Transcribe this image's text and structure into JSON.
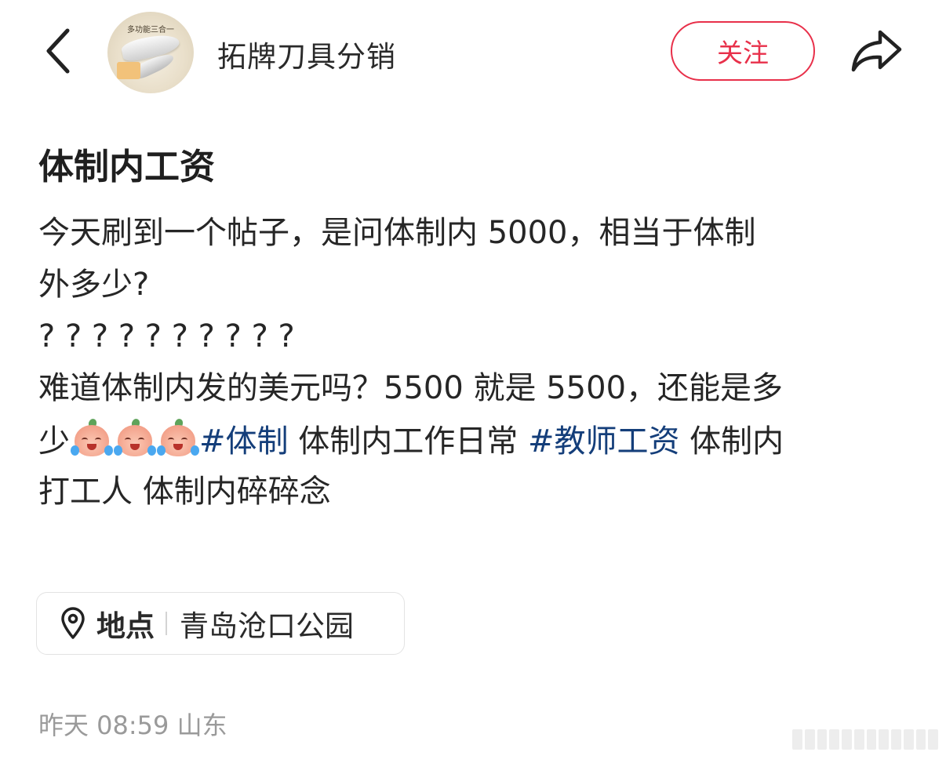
{
  "header": {
    "back_icon": "chevron-left-icon",
    "avatar_caption": "多功能三合一",
    "account_name": "拓牌刀具分销",
    "follow_label": "关注",
    "share_icon": "share-arrow-icon"
  },
  "post": {
    "title": "体制内工资",
    "body": {
      "line1": "今天刷到一个帖子，是问体制内 5000，相当于体制",
      "line2": "外多少?",
      "line3": "? ? ? ? ? ? ? ? ? ?",
      "line4": "难道体制内发的美元吗？5500 就是 5500，还能是多",
      "line5_prefix": "少",
      "emoji_name": "crying-peach-emoji",
      "hashtag1": "#体制",
      "tag_text1": " 体制内工作日常 ",
      "hashtag2": "#教师工资",
      "tag_text2": " 体制内",
      "line6": "打工人 体制内碎碎念"
    }
  },
  "location": {
    "icon": "location-pin-icon",
    "label": "地点",
    "value": "青岛沧口公园"
  },
  "meta": {
    "time_location": "昨天 08:59 山东"
  },
  "colors": {
    "accent": "#e8304a",
    "hashtag": "#143e7a",
    "meta_text": "#9a9a9a"
  }
}
